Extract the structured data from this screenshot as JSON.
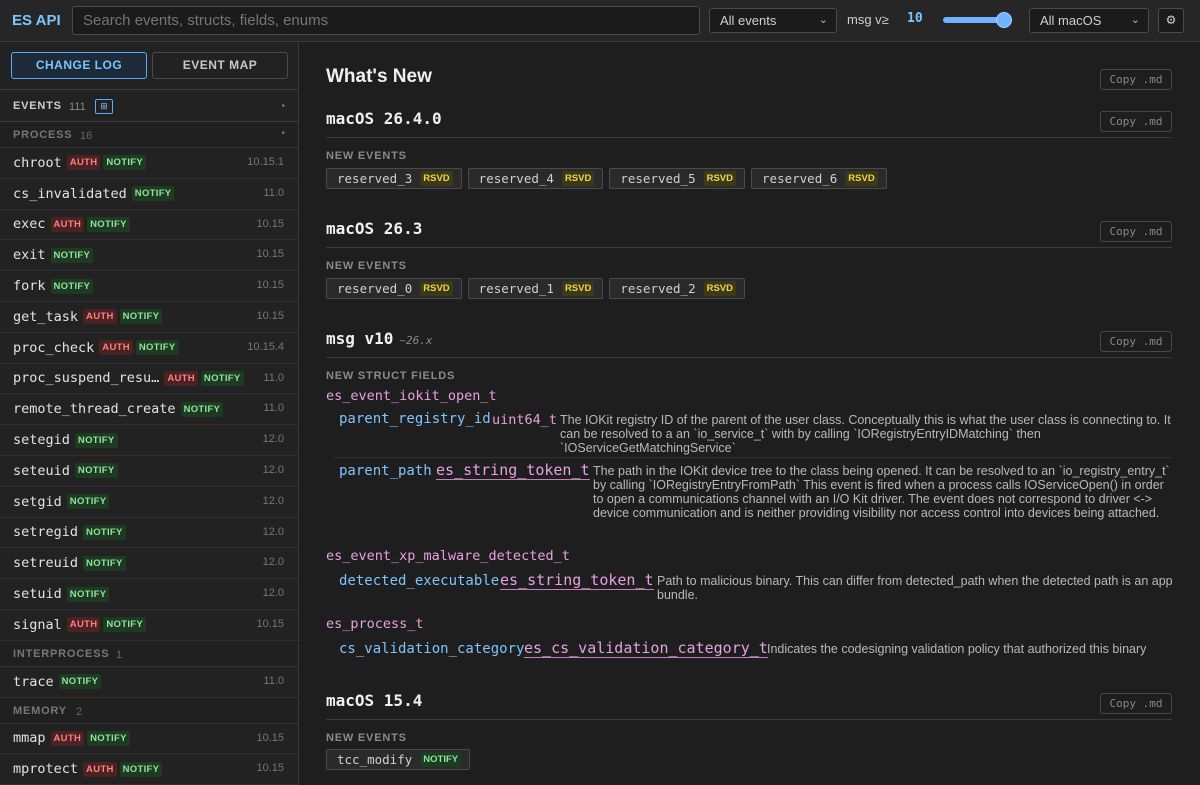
{
  "app": {
    "title": "ES API"
  },
  "search": {
    "placeholder": "Search events, structs, fields, enums"
  },
  "filters": {
    "events_select": "All events",
    "msg_label": "msg v≥",
    "msg_value": "10",
    "msg_slider_fraction": 0.9,
    "macos_select": "All macOS"
  },
  "icons": {
    "gear": "gear-icon",
    "chevron": "chevron-down-icon",
    "grid": "grid-icon"
  },
  "sidebar": {
    "tabs": [
      {
        "label": "CHANGE LOG",
        "active": true
      },
      {
        "label": "EVENT MAP",
        "active": false
      }
    ],
    "events_header": {
      "title": "EVENTS",
      "count": "111"
    },
    "categories": [
      {
        "name": "PROCESS",
        "count": "16"
      },
      {
        "name": "INTERPROCESS",
        "count": "1"
      },
      {
        "name": "MEMORY",
        "count": "2"
      }
    ],
    "events": [
      {
        "name": "chroot",
        "auth": "AUTH",
        "notify": "NOTIFY",
        "version": "10.15.1"
      },
      {
        "name": "cs_invalidated",
        "notify": "NOTIFY",
        "version": "11.0"
      },
      {
        "name": "exec",
        "auth": "AUTH",
        "notify": "NOTIFY",
        "version": "10.15"
      },
      {
        "name": "exit",
        "notify": "NOTIFY",
        "version": "10.15"
      },
      {
        "name": "fork",
        "notify": "NOTIFY",
        "version": "10.15"
      },
      {
        "name": "get_task",
        "auth": "AUTH",
        "notify": "NOTIFY",
        "version": "10.15"
      },
      {
        "name": "proc_check",
        "auth": "AUTH",
        "notify": "NOTIFY",
        "version": "10.15.4"
      },
      {
        "name": "proc_suspend_resu…",
        "auth": "AUTH",
        "notify": "NOTIFY",
        "version": "11.0"
      },
      {
        "name": "remote_thread_create",
        "notify": "NOTIFY",
        "version": "11.0"
      },
      {
        "name": "setegid",
        "notify": "NOTIFY",
        "version": "12.0"
      },
      {
        "name": "seteuid",
        "notify": "NOTIFY",
        "version": "12.0"
      },
      {
        "name": "setgid",
        "notify": "NOTIFY",
        "version": "12.0"
      },
      {
        "name": "setregid",
        "notify": "NOTIFY",
        "version": "12.0"
      },
      {
        "name": "setreuid",
        "notify": "NOTIFY",
        "version": "12.0"
      },
      {
        "name": "setuid",
        "notify": "NOTIFY",
        "version": "12.0"
      },
      {
        "name": "signal",
        "auth": "AUTH",
        "notify": "NOTIFY",
        "version": "10.15"
      },
      {
        "name": "trace",
        "notify": "NOTIFY",
        "version": "11.0"
      },
      {
        "name": "mmap",
        "auth": "AUTH",
        "notify": "NOTIFY",
        "version": "10.15"
      },
      {
        "name": "mprotect",
        "auth": "AUTH",
        "notify": "NOTIFY",
        "version": "10.15"
      }
    ]
  },
  "main": {
    "title": "What's New",
    "copy_label": "Copy .md",
    "new_events_label": "NEW EVENTS",
    "new_struct_fields_label": "NEW STRUCT FIELDS",
    "rsvd": "RSVD",
    "notify": "NOTIFY",
    "sections": [
      {
        "heading": "macOS 26.4.0",
        "events": [
          "reserved_3",
          "reserved_4",
          "reserved_5",
          "reserved_6"
        ]
      },
      {
        "heading": "macOS 26.3",
        "events": [
          "reserved_0",
          "reserved_1",
          "reserved_2"
        ]
      },
      {
        "heading": "msg v10",
        "sub": "~26.x"
      },
      {
        "heading": "macOS 15.4",
        "events": [
          "tcc_modify"
        ]
      }
    ],
    "structs": [
      {
        "name": "es_event_iokit_open_t",
        "fields": [
          {
            "name": "parent_registry_id",
            "type": "uint64_t",
            "desc": "The IOKit registry ID of the parent of the user class. Conceptually this is what the user class is connecting to. It can be resolved to a an `io_service_t` with by calling `IORegistryEntryIDMatching` then `IOServiceGetMatchingService`"
          },
          {
            "name": "parent_path",
            "type": "es_string_token_t",
            "desc": "The path in the IOKit device tree to the class being opened. It can be resolved to an `io_registry_entry_t` by calling `IORegistryEntryFromPath` This event is fired when a process calls IOServiceOpen() in order to open a communications channel with an I/O Kit driver. The event does not correspond to driver <-> device communication and is neither providing visibility nor access control into devices being attached."
          }
        ]
      },
      {
        "name": "es_event_xp_malware_detected_t",
        "fields": [
          {
            "name": "detected_executable",
            "type": "es_string_token_t",
            "desc": "Path to malicious binary. This can differ from detected_path when the detected path is an app bundle."
          }
        ]
      },
      {
        "name": "es_process_t",
        "fields": [
          {
            "name": "cs_validation_category",
            "type": "es_cs_validation_category_t",
            "desc": "Indicates the codesigning validation policy that authorized this binary"
          }
        ]
      }
    ]
  }
}
